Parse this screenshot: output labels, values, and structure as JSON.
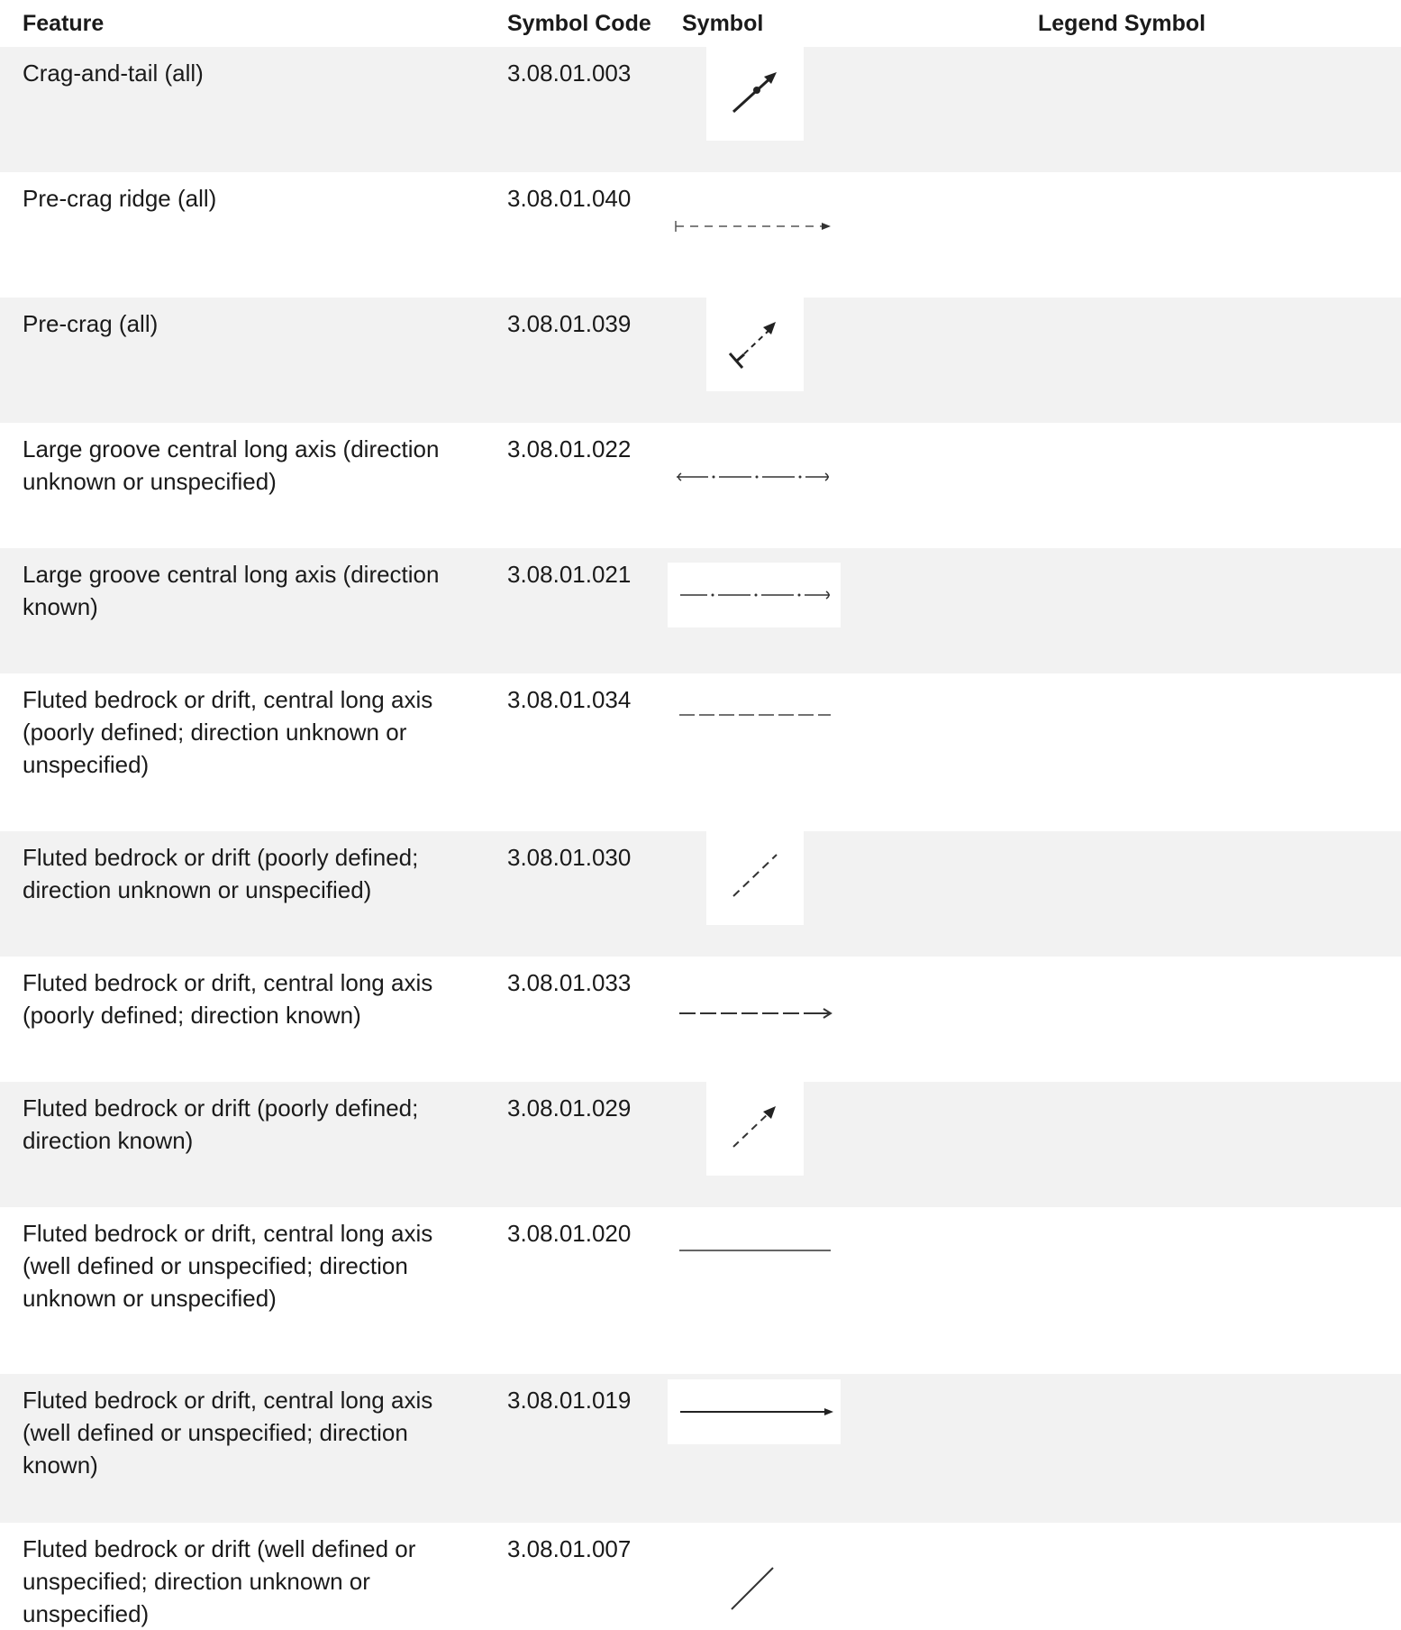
{
  "table": {
    "headers": {
      "feature": "Feature",
      "symbol_code": "Symbol Code",
      "symbol": "Symbol",
      "legend_symbol": "Legend Symbol"
    },
    "rows": [
      {
        "feature": "Crag-and-tail (all)",
        "code": "3.08.01.003",
        "symbol_icon": "crag-and-tail-arrow-icon"
      },
      {
        "feature": "Pre-crag ridge (all)",
        "code": "3.08.01.040",
        "symbol_icon": "pre-crag-ridge-dashed-arrow-icon"
      },
      {
        "feature": "Pre-crag (all)",
        "code": "3.08.01.039",
        "symbol_icon": "pre-crag-arrow-icon"
      },
      {
        "feature": "Large groove central long axis (direction unknown or unspecified)",
        "code": "3.08.01.022",
        "symbol_icon": "large-groove-bidirectional-icon"
      },
      {
        "feature": "Large groove central long axis (direction known)",
        "code": "3.08.01.021",
        "symbol_icon": "large-groove-directional-icon"
      },
      {
        "feature": "Fluted bedrock or drift, central long axis (poorly defined; direction unknown or unspecified)",
        "code": "3.08.01.034",
        "symbol_icon": "dashed-line-icon"
      },
      {
        "feature": "Fluted bedrock or drift (poorly defined; direction unknown or unspecified)",
        "code": "3.08.01.030",
        "symbol_icon": "diagonal-dashed-line-icon"
      },
      {
        "feature": "Fluted bedrock or drift, central long axis (poorly defined; direction known)",
        "code": "3.08.01.033",
        "symbol_icon": "dashed-arrow-icon"
      },
      {
        "feature": "Fluted bedrock or drift (poorly defined; direction known)",
        "code": "3.08.01.029",
        "symbol_icon": "diagonal-dashed-arrow-icon"
      },
      {
        "feature": "Fluted bedrock or drift, central long axis (well defined or unspecified; direction unknown or unspecified)",
        "code": "3.08.01.020",
        "symbol_icon": "solid-line-icon"
      },
      {
        "feature": "Fluted bedrock or drift, central long axis (well defined or unspecified; direction known)",
        "code": "3.08.01.019",
        "symbol_icon": "solid-arrow-icon"
      },
      {
        "feature": "Fluted bedrock or drift (well defined or unspecified; direction unknown or unspecified)",
        "code": "3.08.01.007",
        "symbol_icon": "diagonal-solid-line-icon"
      }
    ]
  },
  "colors": {
    "row_shade": "#f2f2f2",
    "text": "#1a1a1a",
    "symbol_stroke": "#222222"
  }
}
